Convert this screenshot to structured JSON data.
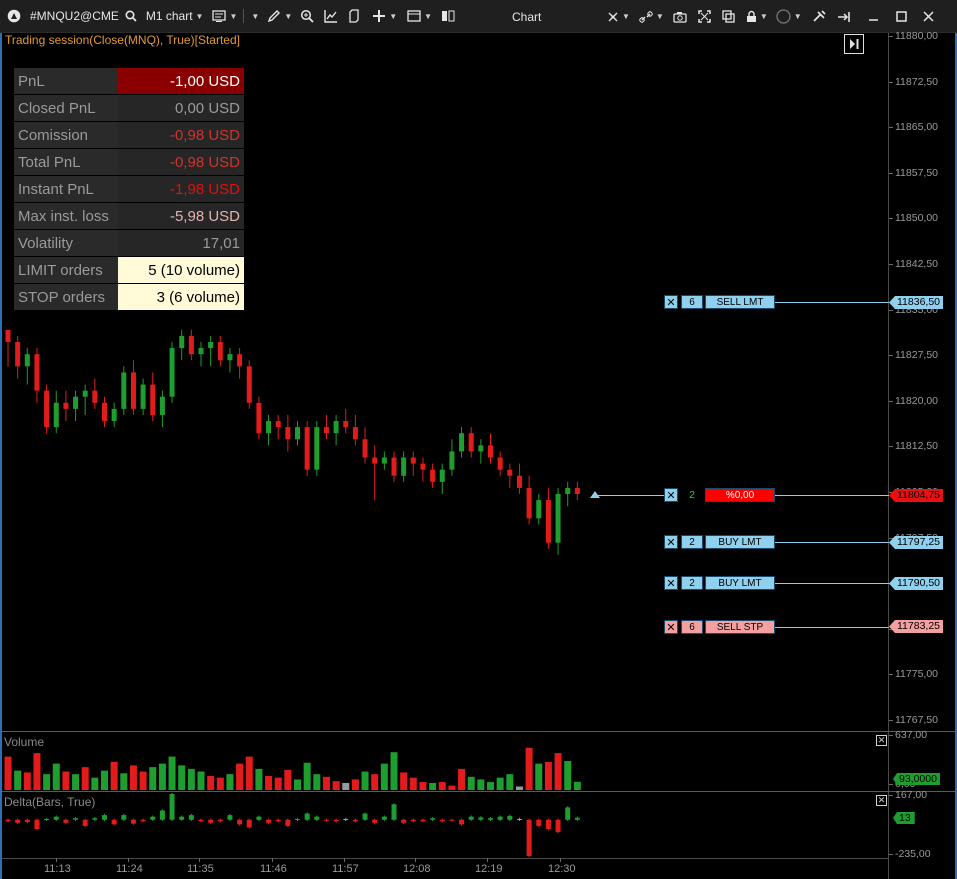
{
  "toolbar": {
    "symbol": "#MNQU2@CME",
    "timeframe": "M1 chart",
    "title": "Chart"
  },
  "session": {
    "label": "Trading session(Close(MNQ), True)[Started]"
  },
  "pnl_table": [
    {
      "label": "PnL",
      "value": "-1,00 USD",
      "bg": "#8a0000",
      "color": "#ffffff"
    },
    {
      "label": "Closed PnL",
      "value": "0,00 USD",
      "bg": "#262626",
      "color": "#9a9a9a"
    },
    {
      "label": "Comission",
      "value": "-0,98 USD",
      "bg": "#262626",
      "color": "#d0342c"
    },
    {
      "label": "Total PnL",
      "value": "-0,98 USD",
      "bg": "#262626",
      "color": "#d0342c"
    },
    {
      "label": "Instant PnL",
      "value": "-1,98 USD",
      "bg": "#262626",
      "color": "#e01010"
    },
    {
      "label": "Max inst. loss",
      "value": "-5,98 USD",
      "bg": "#262626",
      "color": "#e6b0b0"
    },
    {
      "label": "Volatility",
      "value": "17,01",
      "bg": "#262626",
      "color": "#9a9a9a"
    },
    {
      "label": "LIMIT orders",
      "value": "5 (10 volume)",
      "bg": "#fffbd9",
      "color": "#000000"
    },
    {
      "label": "STOP orders",
      "value": "3 (6 volume)",
      "bg": "#fffbd9",
      "color": "#000000"
    }
  ],
  "price_axis": {
    "labels": [
      "11880,00",
      "11872,50",
      "11865,00",
      "11857,50",
      "11850,00",
      "11842,50",
      "11835,00",
      "11827,50",
      "11820,00",
      "11812,50",
      "11805,00",
      "11797,50",
      "11790,00",
      "11783,25",
      "11775,00",
      "11767,50"
    ]
  },
  "orders": [
    {
      "qty": "6",
      "label": "SELL LMT",
      "tag": "11836,50",
      "color": "#8fd0ee",
      "x_color": "#8fd0ee",
      "qty_color": "#8fd0ee",
      "lab_color": "#8fd0ee",
      "line_color": "#8fd0ee",
      "tag_color": "#8fd0ee"
    },
    {
      "qty": "2",
      "label": "%0,00",
      "tag": "11804,75",
      "color": "#8fd0ee",
      "x_color": "#8fd0ee",
      "qty_color": "#000000",
      "qty_text": "#2cd13a",
      "lab_color": "#ff0000",
      "line_color": "#8fd0ee",
      "tag_color": "#e81010"
    },
    {
      "qty": "2",
      "label": "BUY LMT",
      "tag": "11797,25",
      "color": "#8fd0ee",
      "x_color": "#8fd0ee",
      "qty_color": "#8fd0ee",
      "lab_color": "#8fd0ee",
      "line_color": "#8fd0ee",
      "tag_color": "#8fd0ee"
    },
    {
      "qty": "2",
      "label": "BUY LMT",
      "tag": "11790,50",
      "color": "#8fd0ee",
      "x_color": "#8fd0ee",
      "qty_color": "#8fd0ee",
      "lab_color": "#8fd0ee",
      "line_color": "#8fd0ee",
      "tag_color": "#8fd0ee"
    },
    {
      "qty": "6",
      "label": "SELL STP",
      "tag": "11783,25",
      "color": "#f4a0a0",
      "x_color": "#f4a0a0",
      "qty_color": "#f4a0a0",
      "lab_color": "#f4a0a0",
      "line_color": "#f4a0a0",
      "tag_color": "#f4a0a0"
    }
  ],
  "volume_pane": {
    "label": "Volume",
    "axis_top": "637,00",
    "axis_bottom": "0,00",
    "current": "93,0000"
  },
  "delta_pane": {
    "label": "Delta(Bars, True)",
    "axis_top": "167,00",
    "axis_bottom": "-235,00",
    "current": "13"
  },
  "time_axis": {
    "labels": [
      "11:13",
      "11:24",
      "11:35",
      "11:46",
      "11:57",
      "12:08",
      "12:19",
      "12:30"
    ]
  },
  "chart_data": {
    "type": "candlestick",
    "note_colors": {
      "up": "#1e9e2e",
      "down": "#e21b1b"
    },
    "ohlc": [
      [
        11832,
        11832,
        11826,
        11830
      ],
      [
        11830,
        11831,
        11824,
        11826
      ],
      [
        11826,
        11829,
        11823,
        11828
      ],
      [
        11828,
        11829,
        11820,
        11822
      ],
      [
        11822,
        11823,
        11815,
        11816
      ],
      [
        11816,
        11822,
        11815,
        11820
      ],
      [
        11820,
        11822,
        11817,
        11819
      ],
      [
        11819,
        11822,
        11817,
        11821
      ],
      [
        11821,
        11823,
        11818,
        11822
      ],
      [
        11822,
        11824,
        11819,
        11820
      ],
      [
        11820,
        11821,
        11816,
        11817
      ],
      [
        11817,
        11820,
        11816,
        11819
      ],
      [
        11819,
        11826,
        11818,
        11825
      ],
      [
        11825,
        11827,
        11818,
        11819
      ],
      [
        11819,
        11824,
        11818,
        11823
      ],
      [
        11823,
        11825,
        11817,
        11818
      ],
      [
        11818,
        11822,
        11816,
        11821
      ],
      [
        11821,
        11830,
        11820,
        11829
      ],
      [
        11829,
        11832,
        11827,
        11831
      ],
      [
        11831,
        11832,
        11827,
        11828
      ],
      [
        11828,
        11830,
        11826,
        11829
      ],
      [
        11829,
        11831,
        11826,
        11830
      ],
      [
        11830,
        11831,
        11826,
        11827
      ],
      [
        11827,
        11829,
        11825,
        11828
      ],
      [
        11828,
        11829,
        11824,
        11826
      ],
      [
        11826,
        11827,
        11819,
        11820
      ],
      [
        11820,
        11821,
        11814,
        11815
      ],
      [
        11815,
        11818,
        11813,
        11817
      ],
      [
        11817,
        11818,
        11814,
        11816
      ],
      [
        11816,
        11818,
        11812,
        11814
      ],
      [
        11814,
        11817,
        11813,
        11816
      ],
      [
        11816,
        11817,
        11808,
        11809
      ],
      [
        11809,
        11817,
        11808,
        11816
      ],
      [
        11816,
        11818,
        11814,
        11815
      ],
      [
        11815,
        11818,
        11813,
        11817
      ],
      [
        11817,
        11819,
        11815,
        11816
      ],
      [
        11816,
        11818,
        11813,
        11814
      ],
      [
        11814,
        11816,
        11810,
        11811
      ],
      [
        11811,
        11813,
        11804,
        11810
      ],
      [
        11810,
        11812,
        11809,
        11811
      ],
      [
        11811,
        11812,
        11807,
        11808
      ],
      [
        11808,
        11812,
        11807,
        11811
      ],
      [
        11811,
        11812,
        11808,
        11810
      ],
      [
        11810,
        11811,
        11807,
        11809
      ],
      [
        11809,
        11810,
        11806,
        11807
      ],
      [
        11807,
        11810,
        11805,
        11809
      ],
      [
        11809,
        11814,
        11808,
        11812
      ],
      [
        11812,
        11816,
        11811,
        11815
      ],
      [
        11815,
        11816,
        11811,
        11812
      ],
      [
        11812,
        11814,
        11810,
        11813
      ],
      [
        11813,
        11815,
        11810,
        11811
      ],
      [
        11811,
        11812,
        11808,
        11809
      ],
      [
        11809,
        11810,
        11806,
        11808
      ],
      [
        11808,
        11810,
        11805,
        11806
      ],
      [
        11806,
        11808,
        11800,
        11801
      ],
      [
        11801,
        11805,
        11800,
        11804
      ],
      [
        11804,
        11806,
        11796,
        11797
      ],
      [
        11797,
        11806,
        11795,
        11805
      ],
      [
        11805,
        11807,
        11803,
        11806
      ],
      [
        11806,
        11807,
        11804,
        11805
      ]
    ],
    "volume": [
      [
        380,
        "d"
      ],
      [
        220,
        "u"
      ],
      [
        200,
        "d"
      ],
      [
        420,
        "d"
      ],
      [
        180,
        "u"
      ],
      [
        300,
        "u"
      ],
      [
        210,
        "d"
      ],
      [
        180,
        "u"
      ],
      [
        260,
        "d"
      ],
      [
        140,
        "u"
      ],
      [
        220,
        "u"
      ],
      [
        320,
        "d"
      ],
      [
        190,
        "u"
      ],
      [
        280,
        "d"
      ],
      [
        210,
        "d"
      ],
      [
        260,
        "u"
      ],
      [
        300,
        "u"
      ],
      [
        380,
        "u"
      ],
      [
        280,
        "u"
      ],
      [
        240,
        "u"
      ],
      [
        210,
        "u"
      ],
      [
        160,
        "d"
      ],
      [
        140,
        "d"
      ],
      [
        180,
        "u"
      ],
      [
        300,
        "d"
      ],
      [
        380,
        "d"
      ],
      [
        240,
        "u"
      ],
      [
        160,
        "d"
      ],
      [
        140,
        "d"
      ],
      [
        230,
        "d"
      ],
      [
        120,
        "u"
      ],
      [
        310,
        "u"
      ],
      [
        180,
        "u"
      ],
      [
        150,
        "d"
      ],
      [
        100,
        "d"
      ],
      [
        80,
        "g"
      ],
      [
        120,
        "d"
      ],
      [
        210,
        "u"
      ],
      [
        180,
        "d"
      ],
      [
        300,
        "u"
      ],
      [
        430,
        "u"
      ],
      [
        200,
        "d"
      ],
      [
        140,
        "d"
      ],
      [
        90,
        "d"
      ],
      [
        80,
        "u"
      ],
      [
        90,
        "d"
      ],
      [
        50,
        "d"
      ],
      [
        240,
        "d"
      ],
      [
        150,
        "u"
      ],
      [
        120,
        "u"
      ],
      [
        90,
        "u"
      ],
      [
        140,
        "u"
      ],
      [
        180,
        "u"
      ],
      [
        40,
        "g"
      ],
      [
        480,
        "d"
      ],
      [
        300,
        "u"
      ],
      [
        320,
        "d"
      ],
      [
        420,
        "d"
      ],
      [
        330,
        "u"
      ],
      [
        93,
        "u"
      ]
    ],
    "delta": [
      [
        -10,
        "d"
      ],
      [
        -20,
        "d"
      ],
      [
        -15,
        "d"
      ],
      [
        -60,
        "d"
      ],
      [
        5,
        "u"
      ],
      [
        20,
        "u"
      ],
      [
        -20,
        "d"
      ],
      [
        10,
        "u"
      ],
      [
        -40,
        "d"
      ],
      [
        10,
        "u"
      ],
      [
        30,
        "u"
      ],
      [
        -30,
        "d"
      ],
      [
        30,
        "u"
      ],
      [
        -25,
        "d"
      ],
      [
        -10,
        "d"
      ],
      [
        20,
        "u"
      ],
      [
        60,
        "u"
      ],
      [
        167,
        "u"
      ],
      [
        20,
        "u"
      ],
      [
        30,
        "u"
      ],
      [
        -10,
        "d"
      ],
      [
        -20,
        "d"
      ],
      [
        -10,
        "d"
      ],
      [
        30,
        "u"
      ],
      [
        -30,
        "d"
      ],
      [
        -50,
        "d"
      ],
      [
        20,
        "u"
      ],
      [
        -20,
        "d"
      ],
      [
        -10,
        "d"
      ],
      [
        -40,
        "d"
      ],
      [
        5,
        "u"
      ],
      [
        40,
        "u"
      ],
      [
        20,
        "u"
      ],
      [
        -5,
        "d"
      ],
      [
        -10,
        "d"
      ],
      [
        5,
        "g"
      ],
      [
        -10,
        "d"
      ],
      [
        40,
        "u"
      ],
      [
        -20,
        "d"
      ],
      [
        20,
        "u"
      ],
      [
        100,
        "u"
      ],
      [
        -20,
        "d"
      ],
      [
        -10,
        "d"
      ],
      [
        -10,
        "d"
      ],
      [
        10,
        "u"
      ],
      [
        -10,
        "d"
      ],
      [
        -5,
        "d"
      ],
      [
        -30,
        "d"
      ],
      [
        20,
        "u"
      ],
      [
        15,
        "u"
      ],
      [
        10,
        "u"
      ],
      [
        20,
        "u"
      ],
      [
        25,
        "u"
      ],
      [
        5,
        "g"
      ],
      [
        -235,
        "d"
      ],
      [
        -40,
        "d"
      ],
      [
        -60,
        "d"
      ],
      [
        -80,
        "d"
      ],
      [
        80,
        "u"
      ],
      [
        13,
        "u"
      ]
    ]
  }
}
